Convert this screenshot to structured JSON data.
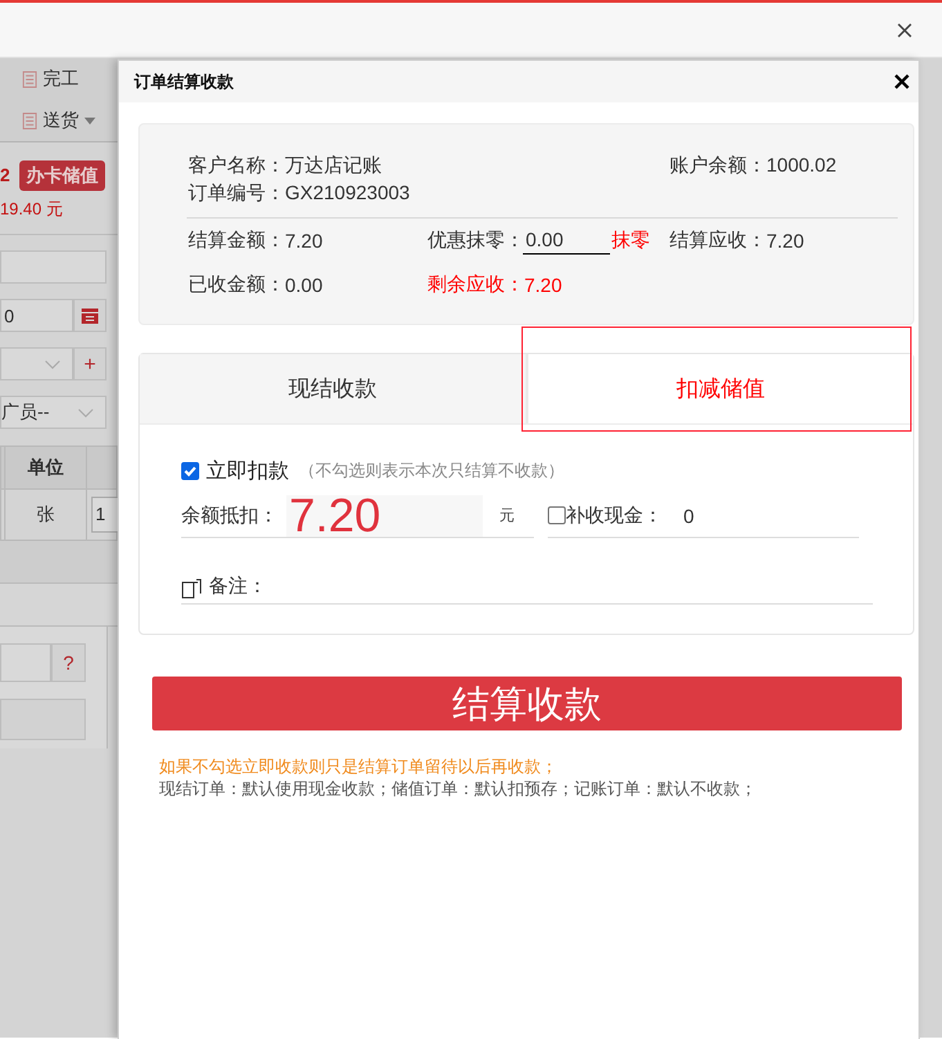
{
  "background": {
    "toolbar": [
      {
        "label": "完工",
        "caret": false
      },
      {
        "label": "送货",
        "caret": true
      }
    ],
    "count": "2",
    "badge": "办卡储值",
    "amount": "19.40 元",
    "date_value": "0",
    "add_button": "+",
    "select_value": "广员--",
    "table": {
      "columns": [
        "单位"
      ],
      "rows": [
        [
          "张",
          "1"
        ]
      ]
    },
    "help_button": "?"
  },
  "dialog": {
    "title": "订单结算收款",
    "customer": [
      {
        "label": "客户名称：",
        "value": "万达店记账"
      },
      {
        "label": "订单编号：",
        "value": "GX210923003"
      }
    ],
    "balance": {
      "label": "账户余额：",
      "value": "1000.02"
    },
    "amounts": [
      [
        {
          "kind": "text",
          "label": "结算金额：",
          "value": "7.20"
        },
        {
          "kind": "input",
          "label": "优惠抹零：",
          "value": "0.00",
          "action": "抹零"
        },
        {
          "kind": "text",
          "label": "结算应收：",
          "value": "7.20"
        }
      ],
      [
        {
          "kind": "text",
          "label": "已收金额：",
          "value": "0.00"
        },
        {
          "kind": "alert",
          "label": "剩余应收：",
          "value": "7.20"
        }
      ]
    ],
    "tabs": [
      {
        "label": "现结收款",
        "selected": false,
        "highlighted": false
      },
      {
        "label": "扣减储值",
        "selected": true,
        "highlighted": true
      }
    ],
    "immediate": {
      "label": "立即扣款",
      "checked": true,
      "hint": "（不勾选则表示本次只结算不收款）"
    },
    "deduct": {
      "label": "余额抵扣：",
      "value": "7.20",
      "unit": "元"
    },
    "cash": {
      "label": "补收现金：",
      "value": "0",
      "checked": false
    },
    "remark": {
      "label": "备注："
    },
    "submit": "结算收款",
    "notes": [
      {
        "kind": "warning",
        "text": "如果不勾选立即收款则只是结算订单留待以后再收款；"
      },
      {
        "kind": "info",
        "text": "现结订单：默认使用现金收款；储值订单：默认扣预存；记账订单：默认不收款；"
      }
    ]
  }
}
